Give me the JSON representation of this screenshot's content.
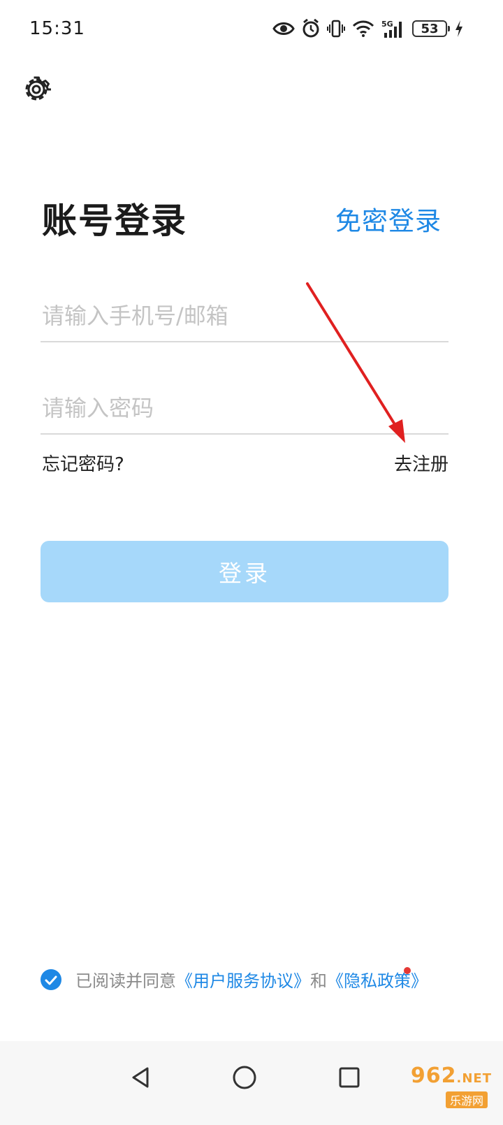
{
  "status_bar": {
    "time": "15:31",
    "battery": "53",
    "icons": [
      "eye-icon",
      "alarm-icon",
      "vibrate-icon",
      "wifi-icon",
      "signal-5g-icon",
      "battery-icon",
      "charging-icon"
    ]
  },
  "header": {
    "settings_icon": "gear-icon"
  },
  "login": {
    "title": "账号登录",
    "passwordless_link": "免密登录",
    "account_placeholder": "请输入手机号/邮箱",
    "password_placeholder": "请输入密码",
    "forgot_password": "忘记密码?",
    "register": "去注册",
    "login_button": "登录"
  },
  "agreement": {
    "checked": true,
    "prefix": "已阅读并同意",
    "user_agreement": "《用户服务协议》",
    "and": "和",
    "privacy_policy": "《隐私政策》"
  },
  "nav_bar": {
    "back_icon": "back-triangle-icon",
    "home_icon": "home-circle-icon",
    "recent_icon": "recent-square-icon"
  },
  "watermark": {
    "logo": "962",
    "suffix": ".NET",
    "subtitle": "乐游网"
  },
  "colors": {
    "accent": "#1e88e5",
    "login_button_bg": "#a6d8fa",
    "annotation_arrow": "#e02020",
    "divider": "#d9d9d9"
  }
}
